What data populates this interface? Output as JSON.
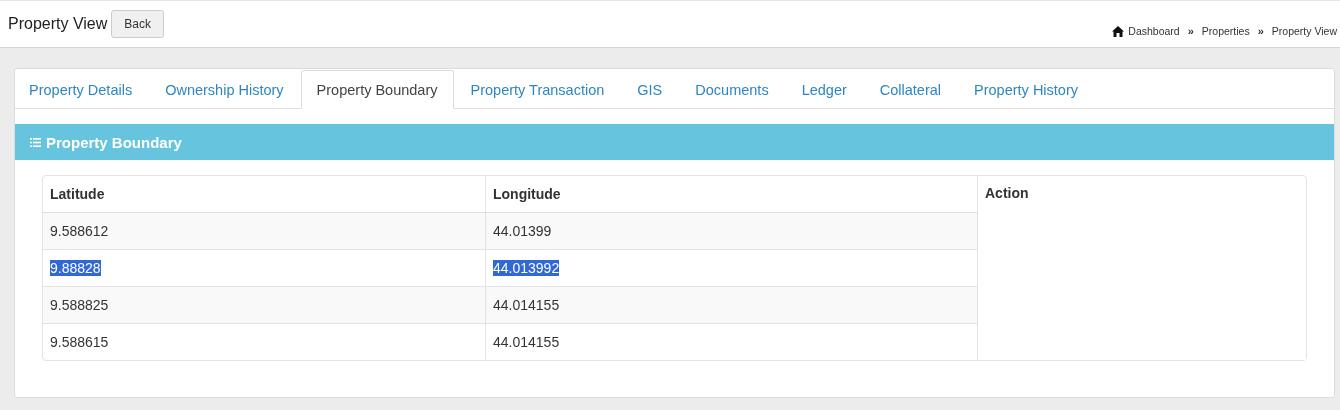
{
  "page_title": "Property View",
  "back_button": "Back",
  "breadcrumb": [
    {
      "label": "Dashboard",
      "kind": "home"
    },
    {
      "label": "Properties",
      "kind": "link"
    },
    {
      "label": "Property View",
      "kind": "current"
    }
  ],
  "breadcrumb_separator": "»",
  "tabs": [
    {
      "label": "Property Details",
      "selected": false
    },
    {
      "label": "Ownership History",
      "selected": false
    },
    {
      "label": "Property Boundary",
      "selected": true
    },
    {
      "label": "Property Transaction",
      "selected": false
    },
    {
      "label": "GIS",
      "selected": false
    },
    {
      "label": "Documents",
      "selected": false
    },
    {
      "label": "Ledger",
      "selected": false
    },
    {
      "label": "Collateral",
      "selected": false
    },
    {
      "label": "Property History",
      "selected": false
    }
  ],
  "panel": {
    "title": "Property Boundary"
  },
  "table": {
    "columns": [
      "Latitude",
      "Longitude",
      "Action"
    ],
    "rows": [
      {
        "latitude": "9.588612",
        "longitude": "44.01399",
        "selected": false
      },
      {
        "latitude": "9.88828",
        "longitude": "44.013992",
        "selected": true
      },
      {
        "latitude": "9.588825",
        "longitude": "44.014155",
        "selected": false
      },
      {
        "latitude": "9.588615",
        "longitude": "44.014155",
        "selected": false
      }
    ]
  }
}
